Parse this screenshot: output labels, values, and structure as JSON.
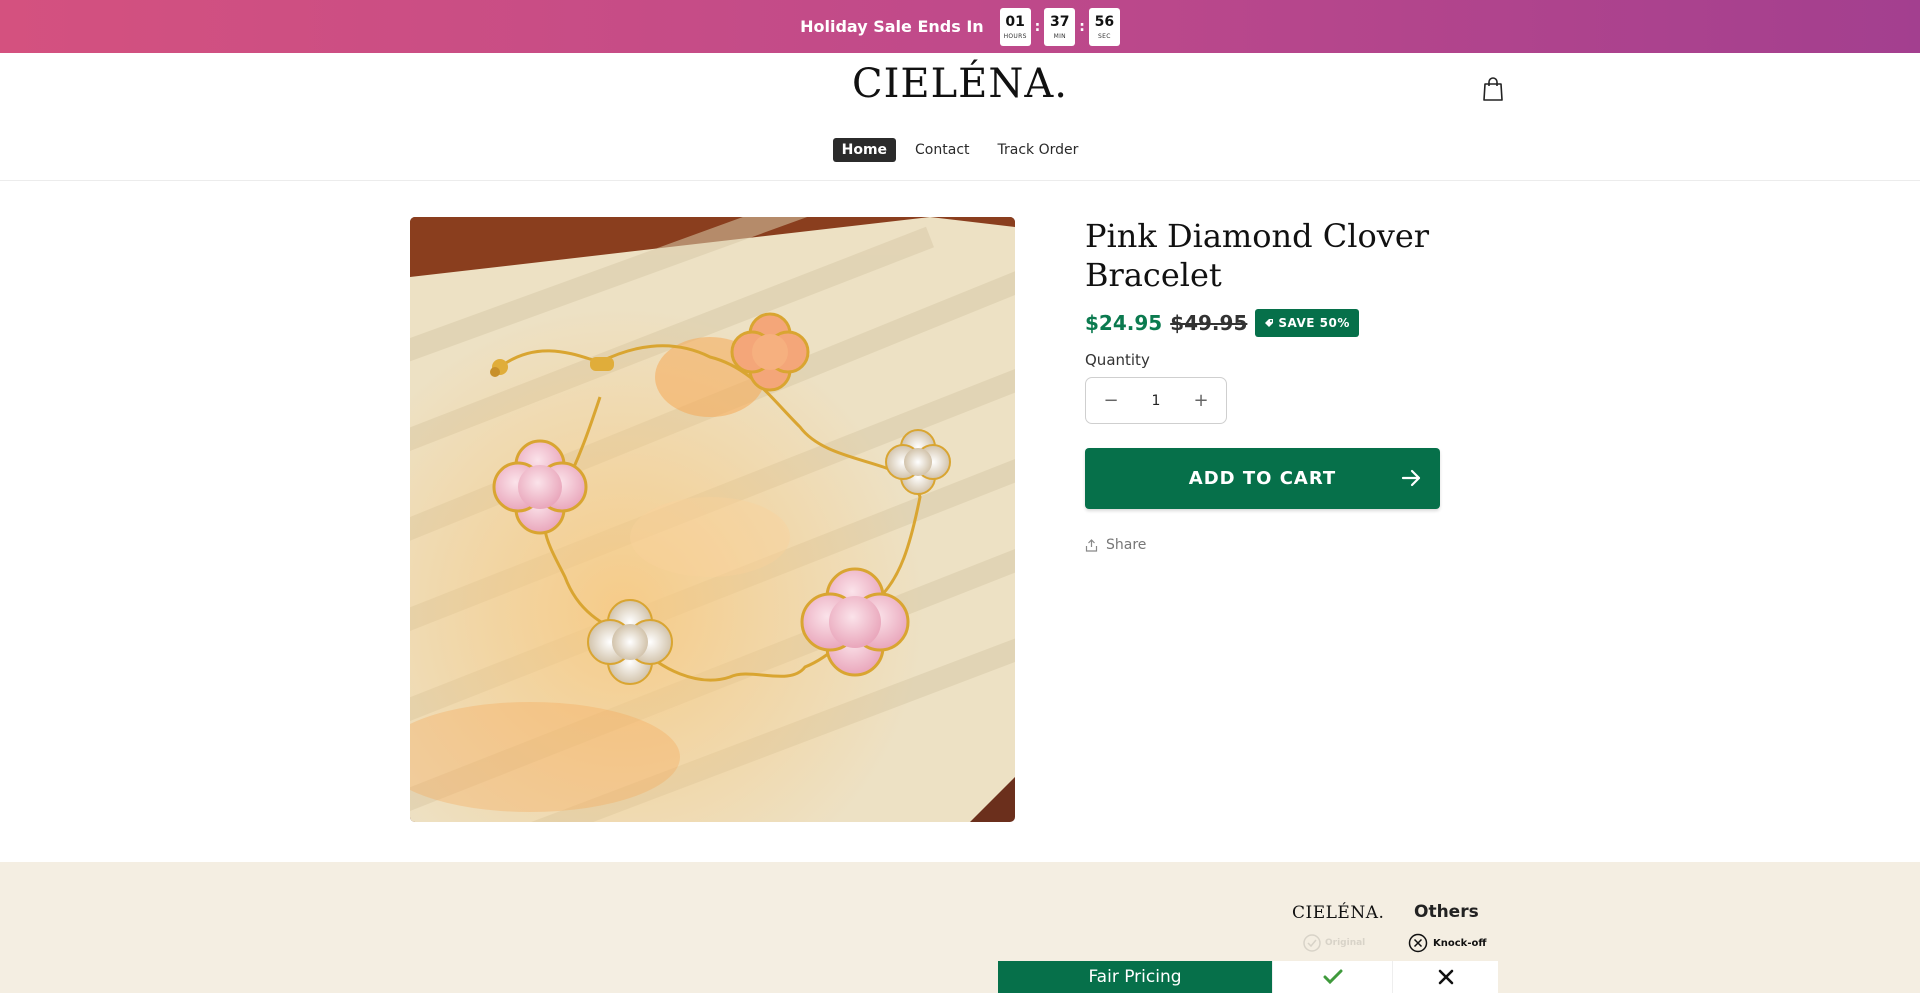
{
  "announcement": {
    "text": "Holiday Sale Ends In",
    "timer": [
      {
        "value": "01",
        "label": "HOURS"
      },
      {
        "value": "37",
        "label": "MIN"
      },
      {
        "value": "56",
        "label": "SEC"
      }
    ],
    "separator": ":"
  },
  "header": {
    "logo": "CIELÉNA.",
    "cart_icon": "shopping-bag-icon",
    "nav": [
      {
        "label": "Home",
        "active": true
      },
      {
        "label": "Contact",
        "active": false
      },
      {
        "label": "Track Order",
        "active": false
      }
    ]
  },
  "product": {
    "title": "Pink Diamond Clover Bracelet",
    "price_sale": "$24.95",
    "price_compare": "$49.95",
    "save_badge": "SAVE 50%",
    "quantity_label": "Quantity",
    "quantity_value": "1",
    "quantity_minus": "−",
    "quantity_plus": "+",
    "add_to_cart": "ADD TO CART",
    "share": "Share"
  },
  "comparison": {
    "brand": "CIELÉNA.",
    "others": "Others",
    "brand_tag": "Original",
    "others_tag": "Knock-off",
    "rows": [
      {
        "feature": "Fair Pricing"
      }
    ]
  },
  "colors": {
    "brand_green": "#06704a",
    "sale_green": "#0b7a4f",
    "banner_start": "#d4517f",
    "banner_end": "#a33f8f",
    "section_bg": "#f4eee2"
  }
}
